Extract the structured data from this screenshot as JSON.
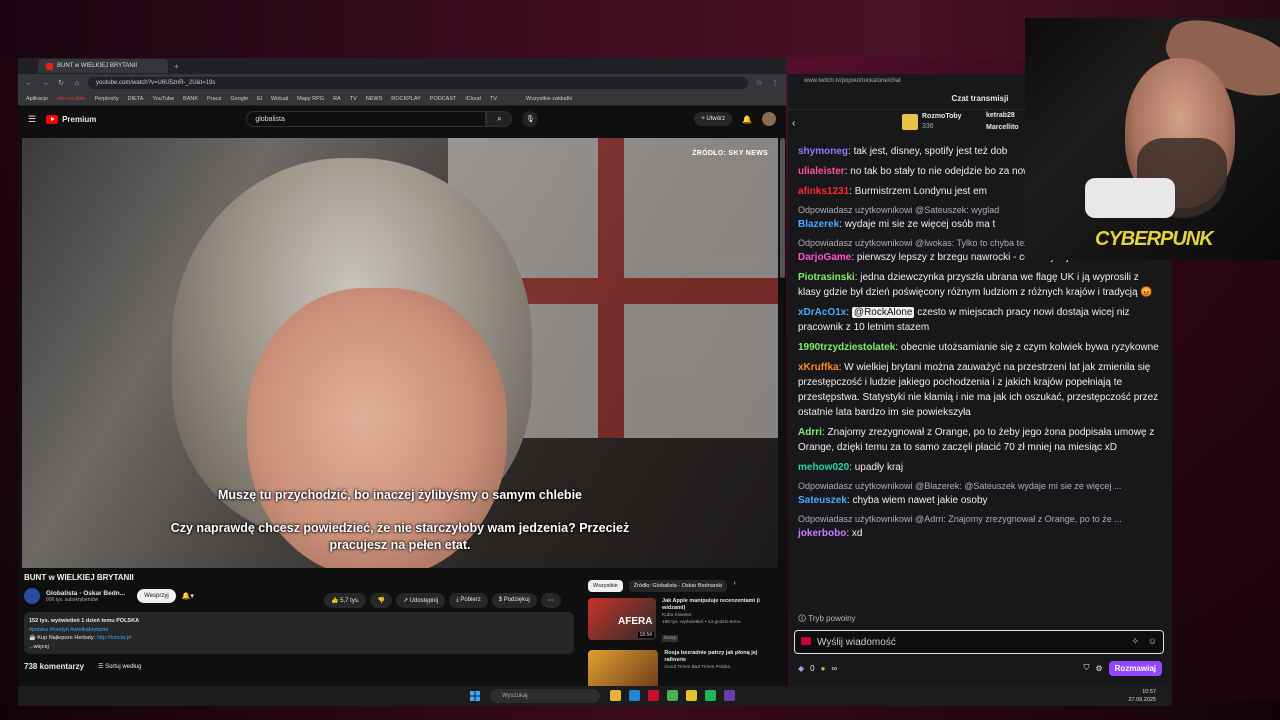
{
  "browser": {
    "tab_title": "BUNT w WIELKIEJ BRYTANII",
    "url": "youtube.com/watch?v=U6U5znR-_2U&t=19s",
    "bookmarks": [
      "Aplikacje",
      "oko na dole",
      "Perplexity",
      "DIETA",
      "YouTube",
      "BANK",
      "Praca",
      "Google",
      "El",
      "Wirtual",
      "Mapy RPG",
      "RA",
      "TV",
      "NEWS",
      "ROCKPLAY",
      "PODCAST",
      "iCloud",
      "TV"
    ],
    "bookmarks_right": "Wszystkie zakładki"
  },
  "youtube": {
    "logo": "Premium",
    "search_value": "globalista",
    "create_label": "Utwórz",
    "source_tag": "ŹRÓDŁO: SKY NEWS",
    "subtitle_line1": "Muszę tu przychodzić, bo inaczej żylibyśmy o samym chlebie",
    "subtitle_line2": "Czy naprawdę chcesz powiedzieć, że nie starczyłoby wam jedzenia? Przecież",
    "subtitle_line3": "pracujesz na pełen etat.",
    "video_title": "BUNT w WIELKIEJ BRYTANII",
    "channel_name": "Globalista - Oskar Bedn...",
    "channel_subs": "906 tys. subskrybentów",
    "support_label": "Wesprzyj",
    "likes": "5,7 tys.",
    "share_label": "Udostępnij",
    "download_label": "Pobierz",
    "thanks_label": "Podziękuj",
    "views_line": "152 tys. wyświetleń  1 dzień temu  POLSKA",
    "hashtags": "#polska #londyn #wielkabrytania",
    "desc_link_prefix": "☕ Kup Najlepsze Herbaty:",
    "desc_link": "http://tuncia.pl",
    "more": "...więcej",
    "comments_count": "738 komentarzy",
    "sort_label": "Sortuj według",
    "chips": [
      "Wszystkie",
      "Źródło: Globalista - Oskar Bednarski"
    ],
    "recs": [
      {
        "title": "Jak Apple manipuluje recenzentami (i widzami)",
        "channel": "Kuba Klawiter",
        "meta": "190 tys. wyświetleń • 14 godzin temu",
        "badge": "Nowy",
        "duration": "18:54",
        "thumb_text": "AFERA"
      },
      {
        "title": "Rosja bezradnie patrzy jak płoną jej rafinerie",
        "channel": "Good Times Bad Times Polska",
        "meta": "",
        "badge": "",
        "duration": "",
        "thumb_text": ""
      }
    ]
  },
  "chat": {
    "url": "www.twitch.tv/popout/rockalone/chat",
    "header": "Czat transmisji",
    "pinned_user": "RozmoToby",
    "pinned_count": "336",
    "pinned_user2": "ketrab28",
    "pinned_user3": "Marcellito",
    "messages": [
      {
        "reply": "",
        "user": "shymoneg",
        "color": "#8a7bff",
        "text": ": tak jest, disney, spotify jest też dob"
      },
      {
        "reply": "",
        "user": "ulialeister",
        "color": "#ff4fa3",
        "text": ": no tak bo stały to nie odejdzie bo za nowego warto skusic"
      },
      {
        "reply": "",
        "user": "afinks1231",
        "color": "#ff2b2b",
        "text": ": Burmistrzem Londynu jest em"
      },
      {
        "reply": "Odpowiadasz użytkownikowi @Sateuszek: wyglad",
        "user": "Blazerek",
        "color": "#4aa8ff",
        "text": ": wydaje mi sie ze więcej osób ma t"
      },
      {
        "reply": "Odpowiadasz użytkownikowi @lwokas: Tylko to chyba tez trochę kwestia chuli...",
        "user": "DarjoGame",
        "color": "#ff4fd8",
        "text": ": pierwszy lepszy z brzegu nawrocki - coś w tym jest"
      },
      {
        "reply": "",
        "user": "Piotrasinski",
        "color": "#7ef06a",
        "text": ": jedna dziewczynka przyszła ubrana we flagę UK i ją wyprosili z klasy gdzie był dzień poświęcony różnym ludziom z różnych krajów i tradycją 😡"
      },
      {
        "reply": "",
        "user": "xDrAcO1x",
        "color": "#4aa8ff",
        "text": " czesto w miejscach pracy nowi dostaja wicej niz pracownik z 10 letnim stazem",
        "mention": "@RockAlone"
      },
      {
        "reply": "",
        "user": "1990trzydziestolatek",
        "color": "#7ef06a",
        "text": ": obecnie utożsamianie się z czym kolwiek bywa ryzykowne"
      },
      {
        "reply": "",
        "user": "xKruffka",
        "color": "#ff8c1a",
        "text": ": W wielkiej brytani można zauważyć na przestrzeni lat jak zmieniła się przestępczość i ludzie jakiego pochodzenia i z jakich krajów popełniają te przestępstwa. Statystyki nie kłamią i nie ma jak ich oszukać, przestępczość przez ostatnie lata bardzo im sie powiekszyła"
      },
      {
        "reply": "",
        "user": "Adrri",
        "color": "#7ef06a",
        "text": ": Znajomy zrezygnował z Orange, po to żeby jego żona podpisała umowę z Orange, dzięki temu za to samo zaczęli płacić 70 zł mniej na miesiąc xD"
      },
      {
        "reply": "",
        "user": "mehow020",
        "color": "#2bd4a8",
        "text": ": upadły kraj"
      },
      {
        "reply": "Odpowiadasz użytkownikowi @Blazerek: @Sateuszek wydaje mi sie ze więcej ...",
        "user": "Sateuszek",
        "color": "#4aa8ff",
        "text": ": chyba wiem nawet jakie osoby"
      },
      {
        "reply": "Odpowiadasz użytkownikowi @Adrri: Znajomy zrezygnował z Orange, po to że ...",
        "user": "jokerbobo",
        "color": "#c77dff",
        "text": ": xd"
      }
    ],
    "paused_label": "Tryb powolny",
    "input_placeholder": "Wyślij wiadomość",
    "points": "0",
    "send_label": "Rozmawiaj"
  },
  "webcam": {
    "logo": "CYBERPUNK"
  },
  "taskbar": {
    "search_placeholder": "Wyszukaj",
    "time": "10:57",
    "date": "27.09.2025"
  }
}
